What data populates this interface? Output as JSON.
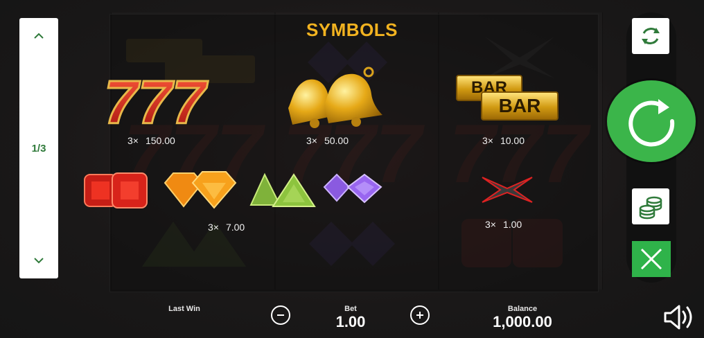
{
  "paytable": {
    "title": "SYMBOLS",
    "rows": [
      {
        "symbol": "triple-seven",
        "count": "3×",
        "value": "150.00"
      },
      {
        "symbol": "bells",
        "count": "3×",
        "value": "50.00"
      },
      {
        "symbol": "double-bar",
        "count": "3×",
        "value": "10.00"
      },
      {
        "symbol": "gems",
        "count": "3×",
        "value": "7.00"
      },
      {
        "symbol": "x-symbol",
        "count": "3×",
        "value": "1.00"
      }
    ],
    "bar_word": "BAR"
  },
  "pager": {
    "page": "1/3"
  },
  "footer": {
    "last_win_label": "Last Win",
    "bet_label": "Bet",
    "bet_value": "1.00",
    "balance_label": "Balance",
    "balance_value": "1,000.00"
  },
  "colors": {
    "accent_gold": "#f2b320",
    "spin_green": "#3bb54a",
    "close_green": "#2fb34a",
    "pager_text_green": "#2f7a3a"
  },
  "icons": {
    "pager_up": "chevron-up-icon",
    "pager_down": "chevron-down-icon",
    "autoplay": "autoplay-icon",
    "spin": "spin-icon",
    "coins": "coins-icon",
    "close": "close-icon",
    "bet_minus": "minus-icon",
    "bet_plus": "plus-icon",
    "sound": "speaker-icon"
  }
}
